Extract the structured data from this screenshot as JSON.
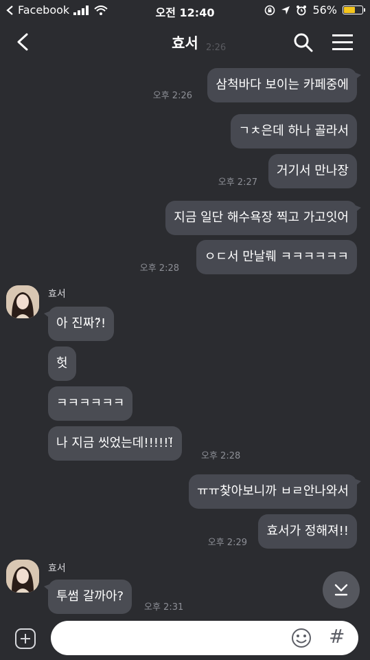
{
  "status_bar": {
    "carrier": "Facebook",
    "time": "오전 12:40",
    "battery_percent": "56%",
    "battery_level": 0.56,
    "icons": [
      "back-arrow-icon",
      "signal-icon",
      "wifi-icon",
      "orientation-lock-icon",
      "location-icon",
      "alarm-icon",
      "battery-icon"
    ]
  },
  "header": {
    "title": "효서",
    "faded_time": "2:26",
    "icons": [
      "back-icon",
      "search-icon",
      "menu-icon"
    ]
  },
  "messages": [
    {
      "from": "me",
      "text": "삼척바다 보이는 카페중에",
      "time": "오후 2:26"
    },
    {
      "from": "me",
      "text": "ㄱㅊ은데 하나 골라서",
      "time": ""
    },
    {
      "from": "me",
      "text": "거기서 만나장",
      "time": "오후 2:27"
    },
    {
      "from": "me",
      "text": "지금 일단 해수욕장 찍고 가고잇어",
      "time": ""
    },
    {
      "from": "me",
      "text": "ㅇㄷ서 만날뤠 ㅋㅋㅋㅋㅋㅋ",
      "time": "오후 2:28"
    },
    {
      "from": "them",
      "sender": "효서",
      "text": "아 진짜?̈!",
      "time": ""
    },
    {
      "from": "them",
      "text": "헛",
      "time": ""
    },
    {
      "from": "them",
      "text": "ㅋㅋㅋㅋㅋㅋ",
      "time": ""
    },
    {
      "from": "them",
      "text": "나 지금 씻었는데!!!!!!̈",
      "time": "오후 2:28"
    },
    {
      "from": "me",
      "text": "ㅠㅠ찾아보니까 ㅂㄹ안나와서",
      "time": ""
    },
    {
      "from": "me",
      "text": "효서가 정해져!!",
      "time": "오후 2:29"
    },
    {
      "from": "them",
      "sender": "효서",
      "text": "투썸 갈까아?",
      "time": "오후 2:31"
    }
  ],
  "input_bar": {
    "placeholder": "",
    "value": "",
    "hash_symbol": "#",
    "icons": [
      "add-icon",
      "emoji-icon",
      "hash-icon"
    ]
  },
  "colors": {
    "background": "#2b2c30",
    "bubble": "#474951",
    "battery": "#f5c61c"
  }
}
